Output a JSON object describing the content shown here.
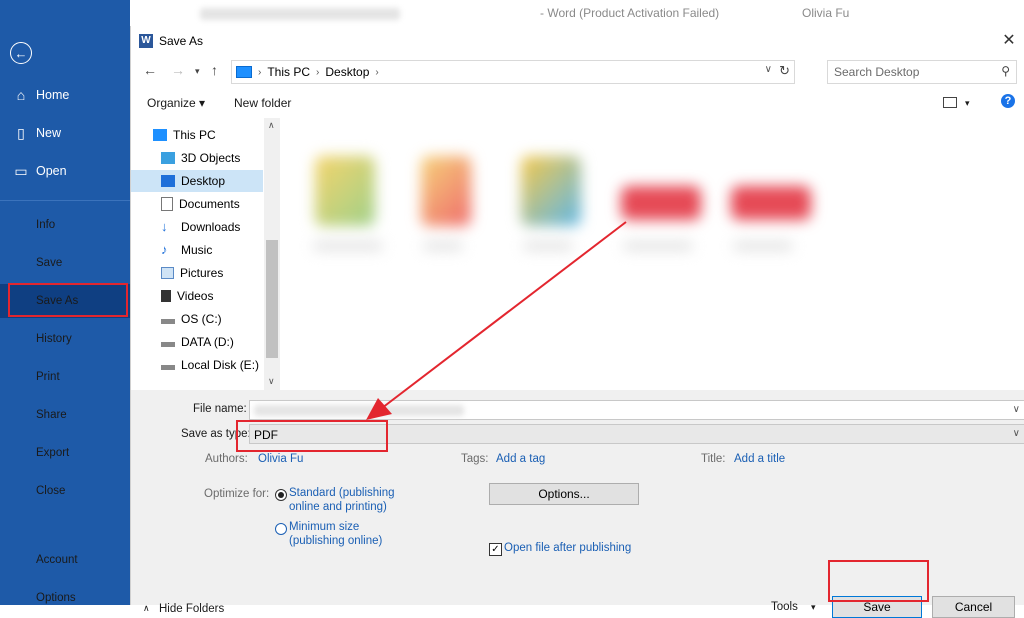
{
  "word": {
    "title_suffix": "- Word (Product Activation Failed)",
    "user": "Olivia Fu"
  },
  "backstage": {
    "items": [
      {
        "label": "Home"
      },
      {
        "label": "New"
      },
      {
        "label": "Open"
      },
      {
        "label": "Info"
      },
      {
        "label": "Save"
      },
      {
        "label": "Save As"
      },
      {
        "label": "History"
      },
      {
        "label": "Print"
      },
      {
        "label": "Share"
      },
      {
        "label": "Export"
      },
      {
        "label": "Close"
      },
      {
        "label": "Account"
      },
      {
        "label": "Options"
      }
    ]
  },
  "dialog": {
    "title": "Save As",
    "close": "✕",
    "breadcrumb": [
      "This PC",
      "Desktop"
    ],
    "search_placeholder": "Search Desktop",
    "toolbar": {
      "organize": "Organize ▾",
      "new_folder": "New folder",
      "help": "?"
    },
    "nav_items": [
      {
        "label": "This PC"
      },
      {
        "label": "3D Objects"
      },
      {
        "label": "Desktop"
      },
      {
        "label": "Documents"
      },
      {
        "label": "Downloads"
      },
      {
        "label": "Music"
      },
      {
        "label": "Pictures"
      },
      {
        "label": "Videos"
      },
      {
        "label": "OS (C:)"
      },
      {
        "label": "DATA (D:)"
      },
      {
        "label": "Local Disk (E:)"
      }
    ],
    "form": {
      "file_name_label": "File name:",
      "save_type_label": "Save as type:",
      "save_type_value": "PDF",
      "authors_label": "Authors:",
      "authors_value": "Olivia Fu",
      "tags_label": "Tags:",
      "tags_value": "Add a tag",
      "title_label": "Title:",
      "title_value": "Add a title",
      "optimize_label": "Optimize for:",
      "opt_standard_1": "Standard (publishing",
      "opt_standard_2": "online and printing)",
      "opt_min_1": "Minimum size",
      "opt_min_2": "(publishing online)",
      "options_button": "Options...",
      "open_after": "Open file after publishing",
      "hide_folders": "Hide Folders",
      "tools": "Tools",
      "save": "Save",
      "cancel": "Cancel"
    }
  },
  "colors": {
    "accent": "#1e5aa8",
    "highlight": "#e3262f",
    "link": "#1a5fb4"
  }
}
